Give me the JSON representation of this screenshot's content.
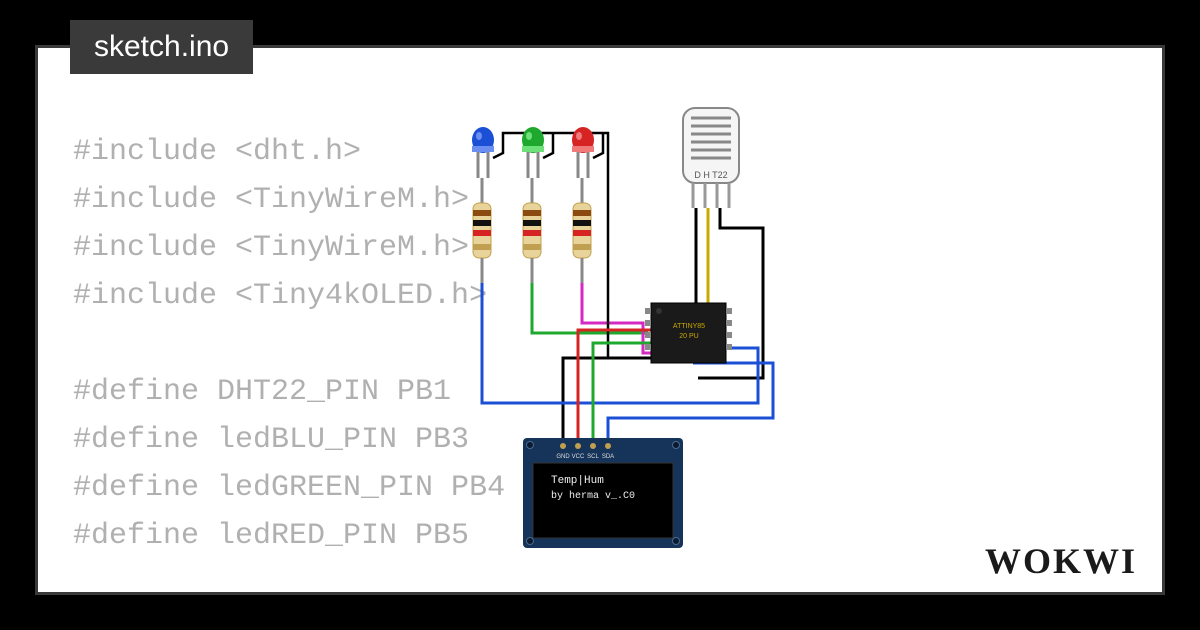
{
  "tab_label": "sketch.ino",
  "code_lines": [
    "#include <dht.h>",
    "#include <TinyWireM.h>",
    "#include <TinyWireM.h>",
    "#include <Tiny4kOLED.h>",
    "",
    "#define DHT22_PIN PB1",
    "#define ledBLU_PIN PB3",
    "#define ledGREEN_PIN PB4",
    "#define ledRED_PIN PB5"
  ],
  "brand": "WOKWI",
  "components": {
    "dht22_label": "D H T22",
    "chip_label_1": "ATTINY85",
    "chip_label_2": "20 PU",
    "oled_pins": [
      "GND",
      "VCC",
      "SCL",
      "SDA"
    ],
    "oled_line1": "Temp|Hum",
    "oled_line2": "by herma   v_.C0",
    "led_colors": [
      "#1a4fd6",
      "#1fa82e",
      "#d62424"
    ]
  }
}
